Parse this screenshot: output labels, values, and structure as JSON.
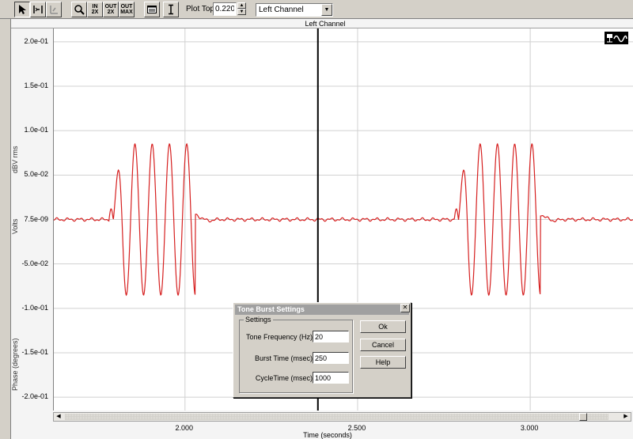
{
  "toolbar": {
    "buttons": [
      {
        "name": "select-arrow-button",
        "icon": "arrow-cursor-icon"
      },
      {
        "name": "cursor-button",
        "icon": "crosshair-cursor-icon"
      },
      {
        "name": "disabled-tool-button",
        "icon": "disabled-tool-icon"
      },
      {
        "name": "zoom-button",
        "icon": "magnifier-icon"
      },
      {
        "name": "zoom-in-2x-button",
        "icon": "zoom-in-icon",
        "line1": "IN",
        "line2": "2X"
      },
      {
        "name": "zoom-out-2x-button",
        "icon": "zoom-out-icon",
        "line1": "OUT",
        "line2": "2X"
      },
      {
        "name": "zoom-out-max-button",
        "icon": "zoom-out-max-icon",
        "line1": "OUT",
        "line2": "MAX"
      },
      {
        "name": "window-layout-button",
        "icon": "window-icon"
      },
      {
        "name": "marker-button",
        "icon": "marker-icon"
      }
    ],
    "plot_top_label": "Plot Top:",
    "plot_top_value": "0.220",
    "channel_selected": "Left Channel"
  },
  "plot": {
    "header_title": "Left Channel",
    "y_axis_labels": {
      "top": "dBV rms",
      "middle": "Volts",
      "bottom": "Phase (degrees)"
    },
    "x_axis_label": "Time (seconds)",
    "legend_icon": "waveform-icon"
  },
  "chart_data": {
    "type": "line",
    "title": "Left Channel",
    "xlabel": "Time (seconds)",
    "ylabel": "Volts",
    "y_ticks": [
      "2.0e-01",
      "1.5e-01",
      "1.0e-01",
      "5.0e-02",
      "7.5e-09",
      "-5.0e-02",
      "-1.0e-01",
      "-1.5e-01",
      "-2.0e-01"
    ],
    "y_tick_values": [
      0.2,
      0.15,
      0.1,
      0.05,
      0.0,
      -0.05,
      -0.1,
      -0.15,
      -0.2
    ],
    "x_ticks": [
      "2.000",
      "2.500",
      "3.000"
    ],
    "x_tick_values": [
      2.0,
      2.5,
      3.0
    ],
    "xlim": [
      1.62,
      3.3
    ],
    "ylim": [
      -0.215,
      0.215
    ],
    "cursor_x": 2.385,
    "grid": true,
    "series": [
      {
        "color": "#d62020",
        "bursts": [
          {
            "start": 1.78,
            "end": 2.03,
            "frequency_hz": 20,
            "amplitude": 0.085
          },
          {
            "start": 2.78,
            "end": 3.03,
            "frequency_hz": 20,
            "amplitude": 0.085
          }
        ]
      }
    ]
  },
  "dialog": {
    "title": "Tone Burst Settings",
    "group_label": "Settings",
    "fields": [
      {
        "label": "Tone Frequency (Hz)",
        "value": "20"
      },
      {
        "label": "Burst Time (msec)",
        "value": "250"
      },
      {
        "label": "CycleTime (msec)",
        "value": "1000"
      }
    ],
    "buttons": {
      "ok": "Ok",
      "cancel": "Cancel",
      "help": "Help"
    }
  }
}
